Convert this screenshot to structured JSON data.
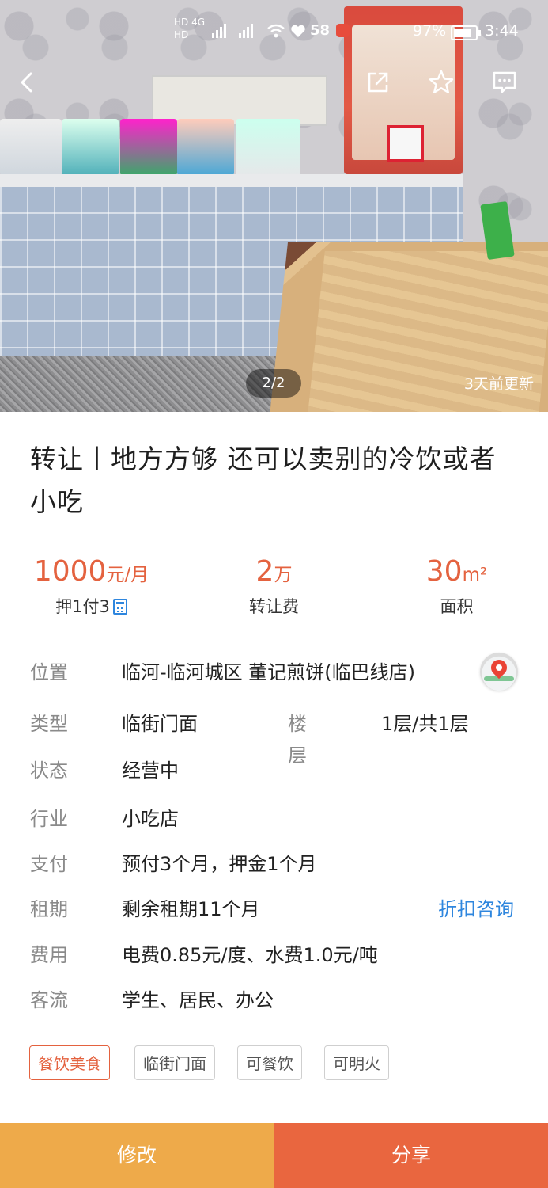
{
  "status_bar": {
    "indicators_top": "HD 4G",
    "indicators_bottom": "HD",
    "network_label": "58",
    "battery": "97%",
    "time": "3:44"
  },
  "gallery": {
    "pager": "2/2",
    "updated": "3天前更新"
  },
  "title": "转让丨地方方够 还可以卖别的冷饮或者小吃",
  "stats": {
    "rent_value": "1000",
    "rent_unit": "元/月",
    "rent_terms": "押1付3",
    "fee_value": "2",
    "fee_unit": "万",
    "fee_label": "转让费",
    "area_value": "30",
    "area_unit": "m²",
    "area_label": "面积"
  },
  "details": {
    "location_label": "位置",
    "location_value": "临河-临河城区 董记煎饼(临巴线店)",
    "type_label": "类型",
    "type_value": "临街门面",
    "floor_label": "楼层",
    "floor_value": "1层/共1层",
    "state_label": "状态",
    "state_value": "经营中",
    "industry_label": "行业",
    "industry_value": "小吃店",
    "payment_label": "支付",
    "payment_value": "预付3个月，押金1个月",
    "lease_label": "租期",
    "lease_value": "剩余租期11个月",
    "discount_link": "折扣咨询",
    "cost_label": "费用",
    "cost_value": "电费0.85元/度、水费1.0元/吨",
    "traffic_label": "客流",
    "traffic_value": "学生、居民、办公"
  },
  "tags": [
    "餐饮美食",
    "临街门面",
    "可餐饮",
    "可明火"
  ],
  "actions": {
    "edit": "修改",
    "share": "分享"
  },
  "colors": {
    "accent": "#e4623f",
    "link": "#2e86de",
    "edit_button": "#eeaa4a",
    "share_button": "#e9663f"
  },
  "icons": [
    "back-arrow-icon",
    "external-share-icon",
    "star-icon",
    "message-icon",
    "calculator-icon",
    "map-pin-icon"
  ]
}
